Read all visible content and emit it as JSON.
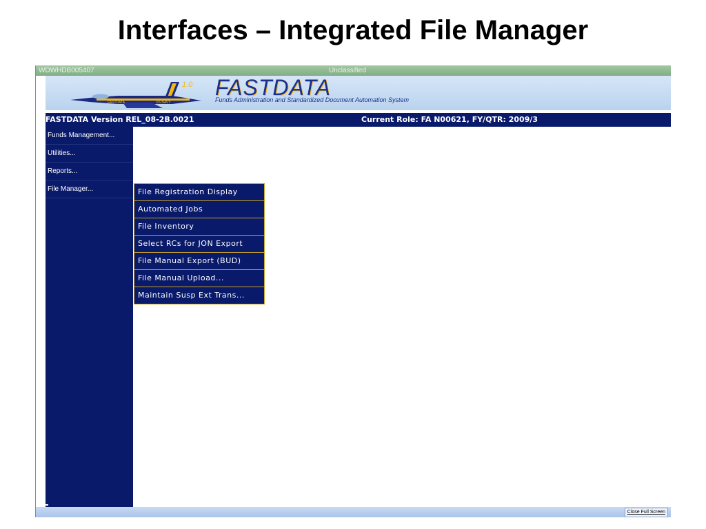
{
  "slide": {
    "title": "Interfaces – Integrated File Manager"
  },
  "window": {
    "id_text": "WDWHDB005407",
    "classification": "Unclassified"
  },
  "banner": {
    "version_badge": "1.0",
    "jet_label_left": "FASTDATA",
    "jet_label_right": "US NAVY",
    "brand_title": "FASTDATA",
    "brand_subtitle": "Funds Administration and Standardized Document Automation System"
  },
  "status": {
    "version": "FASTDATA Version REL_08-2B.0021",
    "role": "Current Role: FA N00621,   FY/QTR: 2009/3"
  },
  "sidebar": {
    "items": [
      {
        "label": "Funds Management..."
      },
      {
        "label": "Utilities..."
      },
      {
        "label": "Reports..."
      },
      {
        "label": "File Manager..."
      }
    ]
  },
  "submenu": {
    "items": [
      {
        "label": "File Registration Display"
      },
      {
        "label": "Automated Jobs"
      },
      {
        "label": "File Inventory"
      },
      {
        "label": "Select RCs for JON Export"
      },
      {
        "label": "File Manual Export (BUD)"
      },
      {
        "label": "File Manual Upload..."
      },
      {
        "label": "Maintain Susp Ext Trans..."
      }
    ]
  },
  "footer": {
    "close_full_screen": "Close Full Screen"
  },
  "colors": {
    "navy": "#0a1a6b",
    "gold_border": "#c9a227",
    "titlebar_green": "#8fba92",
    "banner_blue": "#c7dcf2"
  }
}
